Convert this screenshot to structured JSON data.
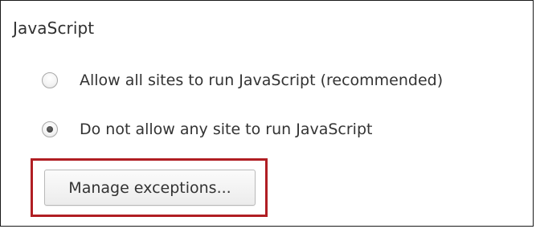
{
  "section": {
    "title": "JavaScript"
  },
  "options": [
    {
      "label": "Allow all sites to run JavaScript (recommended)",
      "selected": false
    },
    {
      "label": "Do not allow any site to run JavaScript",
      "selected": true
    }
  ],
  "manage_button": {
    "label": "Manage exceptions..."
  },
  "colors": {
    "highlight": "#b01e23",
    "text": "#333333"
  }
}
